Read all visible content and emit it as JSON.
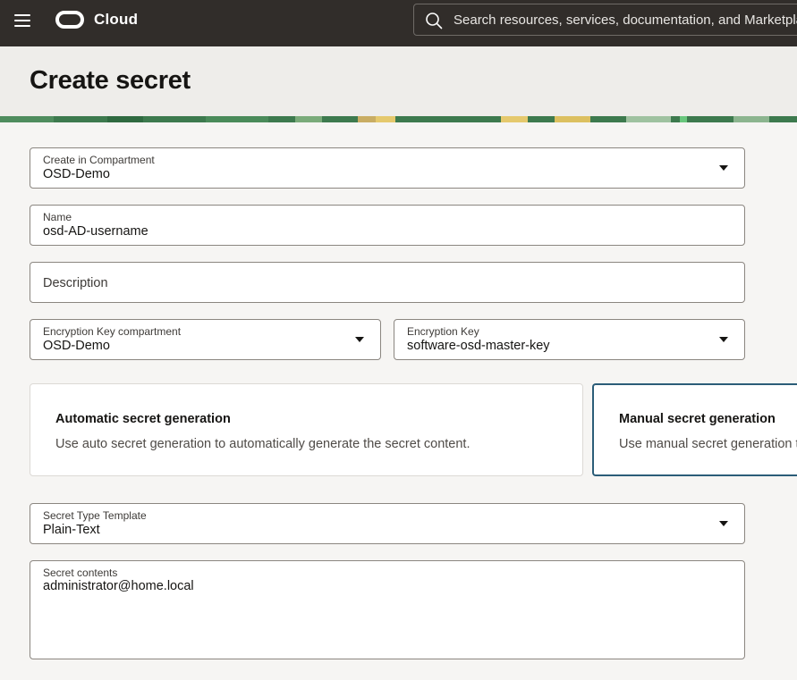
{
  "topbar": {
    "brand": "Cloud",
    "search_placeholder": "Search resources, services, documentation, and Marketplace"
  },
  "page": {
    "title": "Create secret"
  },
  "form": {
    "compartment": {
      "label": "Create in Compartment",
      "value": "OSD-Demo"
    },
    "name": {
      "label": "Name",
      "value": "osd-AD-username"
    },
    "description": {
      "placeholder": "Description"
    },
    "encryption_key_compartment": {
      "label": "Encryption Key compartment",
      "value": "OSD-Demo"
    },
    "encryption_key": {
      "label": "Encryption Key",
      "value": "software-osd-master-key"
    },
    "generation_options": [
      {
        "title": "Automatic secret generation",
        "description": "Use auto secret generation to automatically generate the secret content.",
        "selected": false
      },
      {
        "title": "Manual secret generation",
        "description": "Use manual secret generation to",
        "selected": true
      }
    ],
    "secret_type_template": {
      "label": "Secret Type Template",
      "value": "Plain-Text"
    },
    "secret_contents": {
      "label": "Secret contents",
      "value": "administrator@home.local"
    }
  },
  "colors": {
    "topbar": "#312d2a",
    "selected_border": "#2b5d78",
    "field_border": "#8b8680"
  }
}
